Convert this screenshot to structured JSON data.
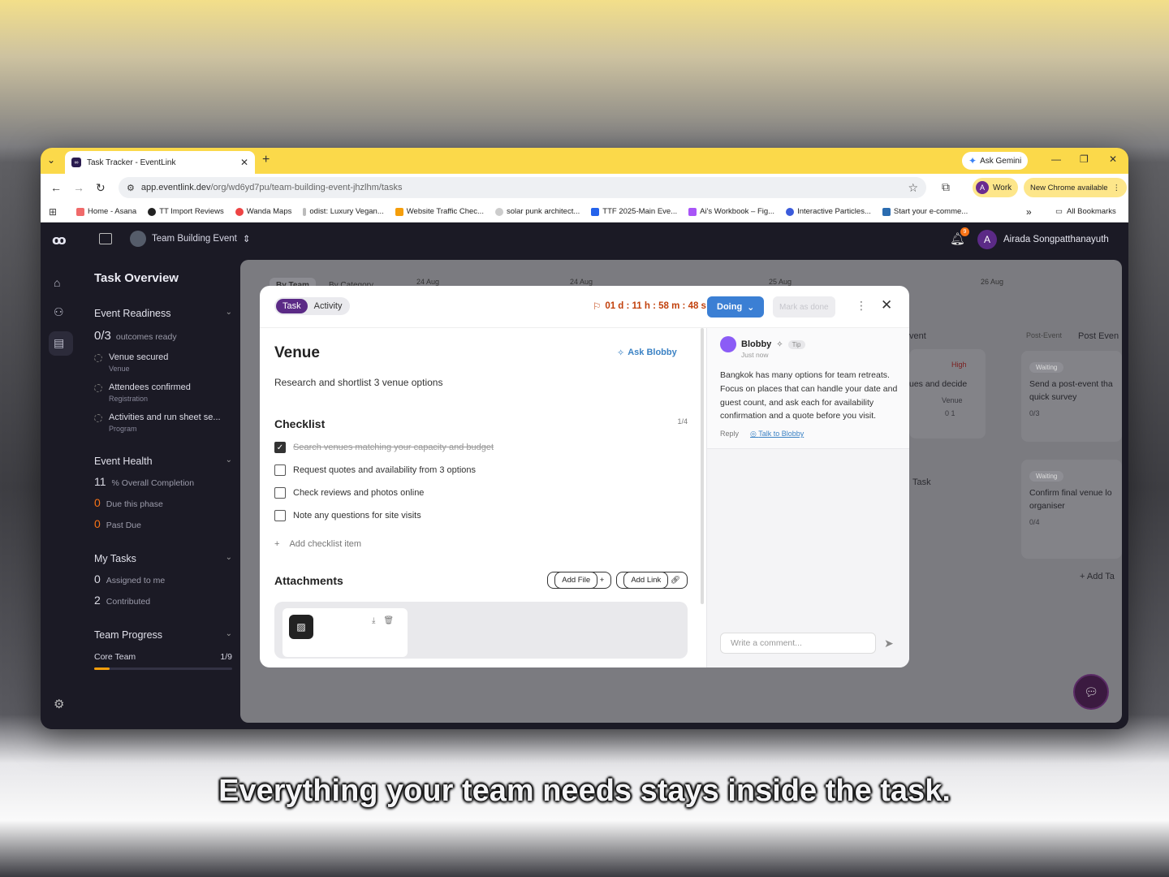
{
  "browser": {
    "tab_title": "Task Tracker - EventLink",
    "gemini": "Ask Gemini",
    "url_main": "app.eventlink.dev",
    "url_path": "/org/wd6yd7pu/team-building-event-jhzlhm/tasks",
    "profile_initial": "A",
    "profile_label": "Work",
    "update_label": "New Chrome available",
    "bookmarks": [
      "Home - Asana",
      "TT Import Reviews",
      "Wanda Maps",
      "odist: Luxury Vegan...",
      "Website Traffic Chec...",
      "solar punk architect...",
      "TTF 2025-Main Eve...",
      "Ai's Workbook – Fig...",
      "Interactive Particles...",
      "Start your e-comme..."
    ],
    "all_bookmarks": "All Bookmarks"
  },
  "app": {
    "event_name": "Team Building Event",
    "notification_count": "9",
    "user_initial": "A",
    "user_name": "Airada Songpatthanayuth"
  },
  "sidebar": {
    "title": "Task Overview",
    "readiness": {
      "label": "Event Readiness",
      "count": "0/3",
      "count_label": "outcomes ready",
      "items": [
        {
          "label": "Venue secured",
          "sub": "Venue"
        },
        {
          "label": "Attendees confirmed",
          "sub": "Registration"
        },
        {
          "label": "Activities and run sheet se...",
          "sub": "Program"
        }
      ]
    },
    "health": {
      "label": "Event Health",
      "completion": "11",
      "completion_label": "% Overall Completion",
      "due": "0",
      "due_label": "Due this phase",
      "past": "0",
      "past_label": "Past Due"
    },
    "my_tasks": {
      "label": "My Tasks",
      "assigned": "0",
      "assigned_label": "Assigned to me",
      "contributed": "2",
      "contributed_label": "Contributed"
    },
    "team_progress": {
      "label": "Team Progress",
      "team": "Core Team",
      "value": "1/9",
      "fraction": 0.11
    }
  },
  "board": {
    "view_tabs": [
      "By Team",
      "By Category"
    ],
    "dates": [
      "24 Aug",
      "24 Aug",
      "25 Aug",
      "26 Aug"
    ],
    "columns": [
      "vent",
      "Post-Event",
      "Post Even"
    ],
    "cards": [
      {
        "status": "Waiting",
        "text": "Send a post-event tha quick survey",
        "meta": "0/3"
      },
      {
        "status": "Waiting",
        "text": "Confirm final venue lo organiser",
        "meta": "0/4"
      }
    ],
    "priority": "High",
    "partial_text": "ues and decide",
    "partial_tag": "Venue",
    "partial_meta": "0   1",
    "task_label": "Task",
    "add_task": "Add Ta"
  },
  "modal": {
    "tab_task": "Task",
    "tab_activity": "Activity",
    "timer": "01 d : 11 h : 58 m : 48 s",
    "status": "Doing",
    "mark_done": "Mark as done",
    "title": "Venue",
    "ask": "Ask Blobby",
    "description": "Research and shortlist 3 venue options",
    "checklist_title": "Checklist",
    "checklist_count": "1/4",
    "checklist": [
      {
        "text": "Search venues matching your capacity and budget",
        "done": true
      },
      {
        "text": "Request quotes and availability from 3 options",
        "done": false
      },
      {
        "text": "Check reviews and photos online",
        "done": false
      },
      {
        "text": "Note any questions for site visits",
        "done": false
      }
    ],
    "add_checklist": "Add checklist item",
    "attachments_title": "Attachments",
    "add_file": "Add File",
    "add_link": "Add Link",
    "comment": {
      "author": "Blobby",
      "tag": "Tip",
      "time": "Just now",
      "body": "Bangkok has many options for team retreats. Focus on places that can handle your date and guest count, and ask each for availability confirmation and a quote before you visit.",
      "reply": "Reply",
      "talk": "Talk to Blobby"
    },
    "comment_placeholder": "Write a comment..."
  },
  "caption": "Everything your team needs stays inside the task."
}
